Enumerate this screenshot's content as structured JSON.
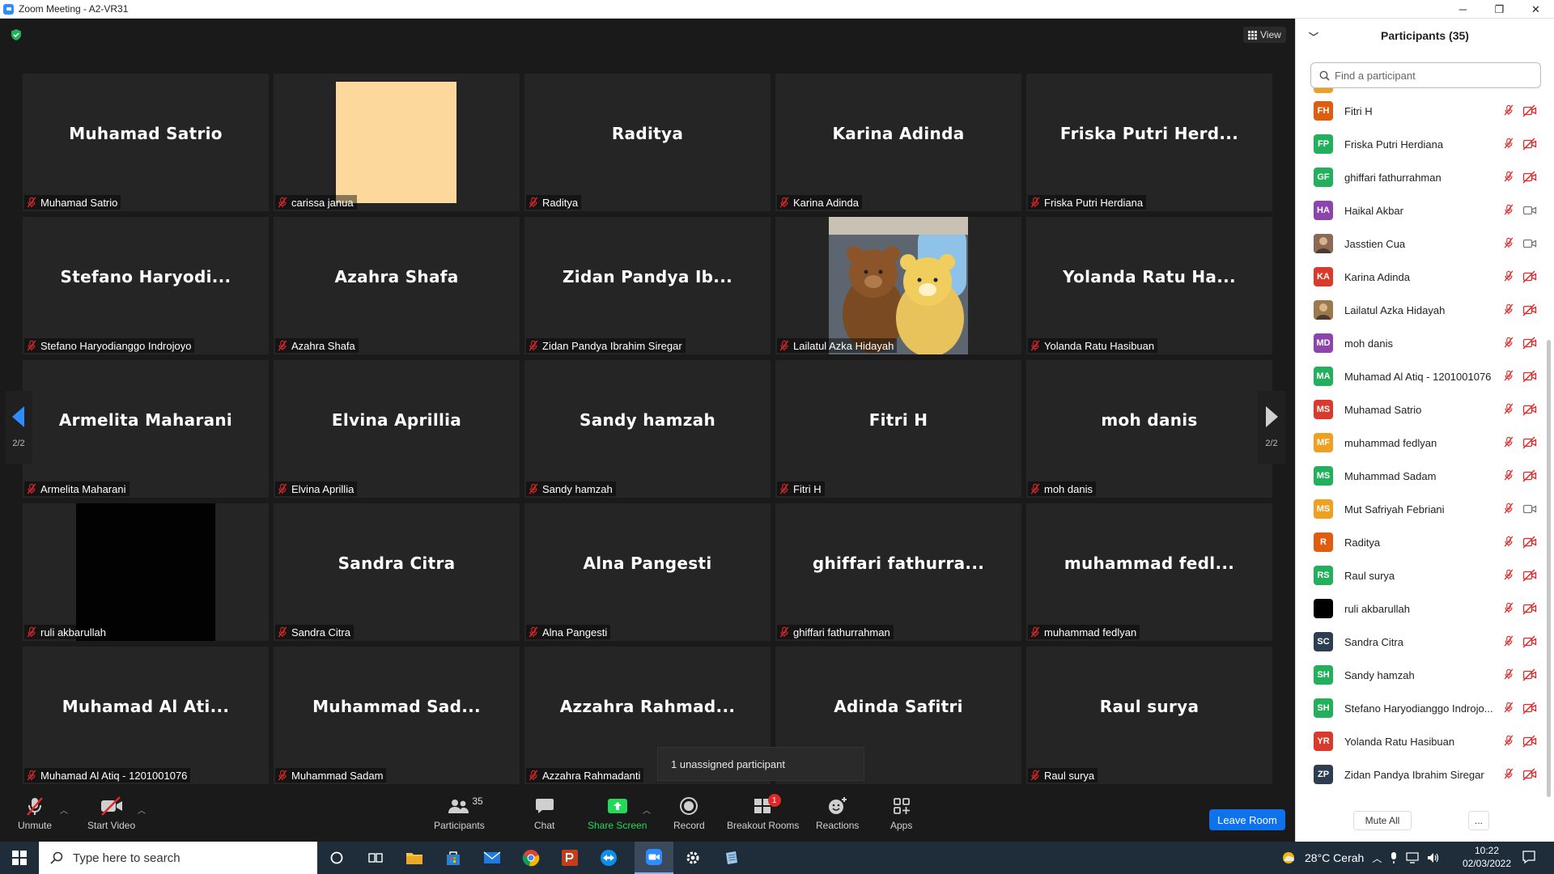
{
  "window": {
    "title": "Zoom Meeting - A2-VR31",
    "min": "─",
    "max": "❐",
    "close": "✕"
  },
  "view_label": "View",
  "pager": {
    "page": "2/2"
  },
  "tiles": [
    {
      "big": "Muhamad Satrio",
      "name": "Muhamad Satrio"
    },
    {
      "big": "",
      "name": "carissa janua",
      "photo": "peach"
    },
    {
      "big": "Raditya",
      "name": "Raditya"
    },
    {
      "big": "Karina Adinda",
      "name": "Karina Adinda"
    },
    {
      "big": "Friska Putri Herd...",
      "name": "Friska Putri Herdiana"
    },
    {
      "big": "Stefano  Haryodi...",
      "name": "Stefano Haryodianggo Indrojoyo"
    },
    {
      "big": "Azahra Shafa",
      "name": "Azahra Shafa"
    },
    {
      "big": "Zidan Pandya Ib...",
      "name": "Zidan Pandya Ibrahim Siregar"
    },
    {
      "big": "",
      "name": "Lailatul Azka Hidayah",
      "photo": "bears"
    },
    {
      "big": "Yolanda Ratu Ha...",
      "name": "Yolanda Ratu Hasibuan"
    },
    {
      "big": "Armelita Maharani",
      "name": "Armelita Maharani"
    },
    {
      "big": "Elvina Aprillia",
      "name": "Elvina Aprillia"
    },
    {
      "big": "Sandy hamzah",
      "name": "Sandy hamzah"
    },
    {
      "big": "Fitri H",
      "name": "Fitri H"
    },
    {
      "big": "moh danis",
      "name": "moh danis"
    },
    {
      "big": "",
      "name": "ruli akbarullah",
      "photo": "black"
    },
    {
      "big": "Sandra Citra",
      "name": "Sandra Citra"
    },
    {
      "big": "Alna Pangesti",
      "name": "Alna Pangesti"
    },
    {
      "big": "ghiffari  fathurra...",
      "name": "ghiffari fathurrahman"
    },
    {
      "big": "muhammad  fedl...",
      "name": "muhammad fedlyan"
    },
    {
      "big": "Muhamad Al Ati...",
      "name": "Muhamad Al Atiq - 1201001076"
    },
    {
      "big": "Muhammad  Sad...",
      "name": "Muhammad Sadam"
    },
    {
      "big": "Azzahra  Rahmad...",
      "name": "Azzahra Rahmadanti"
    },
    {
      "big": "Adinda Safitri",
      "name": ""
    },
    {
      "big": "Raul surya",
      "name": "Raul surya"
    }
  ],
  "unassigned_text": "1 unassigned participant",
  "toolbar": {
    "unmute": "Unmute",
    "start_video": "Start Video",
    "participants": "Participants",
    "participants_count": "35",
    "chat": "Chat",
    "share_screen": "Share Screen",
    "record": "Record",
    "breakout_rooms": "Breakout Rooms",
    "breakout_badge": "1",
    "reactions": "Reactions",
    "apps": "Apps",
    "leave_room": "Leave Room",
    "colors": {
      "share": "#23d959",
      "badge": "#e02828",
      "leave": "#0e72ed"
    }
  },
  "panel": {
    "title": "Participants (35)",
    "search_placeholder": "Find a participant",
    "mute_all": "Mute All",
    "more": "...",
    "participants": [
      {
        "initials": "FH",
        "name": "Fitri H",
        "color": "#e05d10",
        "cam": "off"
      },
      {
        "initials": "FP",
        "name": "Friska Putri Herdiana",
        "color": "#23b05c",
        "cam": "off"
      },
      {
        "initials": "GF",
        "name": "ghiffari fathurrahman",
        "color": "#23b05c",
        "cam": "off"
      },
      {
        "initials": "HA",
        "name": "Haikal Akbar",
        "color": "#8e44ad",
        "cam": "on"
      },
      {
        "initials": "",
        "name": "Jasstien Cua",
        "color": "#8a6a55",
        "cam": "on",
        "photo": true
      },
      {
        "initials": "KA",
        "name": "Karina Adinda",
        "color": "#d93a2b",
        "cam": "off"
      },
      {
        "initials": "",
        "name": "Lailatul Azka Hidayah",
        "color": "#9b7a4a",
        "cam": "off",
        "photo": true
      },
      {
        "initials": "MD",
        "name": "moh danis",
        "color": "#8e44ad",
        "cam": "off"
      },
      {
        "initials": "MA",
        "name": "Muhamad Al Atiq - 1201001076",
        "color": "#23b05c",
        "cam": "off"
      },
      {
        "initials": "MS",
        "name": "Muhamad Satrio",
        "color": "#d93a2b",
        "cam": "off"
      },
      {
        "initials": "MF",
        "name": "muhammad fedlyan",
        "color": "#f0a020",
        "cam": "off"
      },
      {
        "initials": "MS",
        "name": "Muhammad Sadam",
        "color": "#23b05c",
        "cam": "off"
      },
      {
        "initials": "MS",
        "name": "Mut Safriyah Febriani",
        "color": "#f0a020",
        "cam": "on"
      },
      {
        "initials": "R",
        "name": "Raditya",
        "color": "#e05d10",
        "cam": "off"
      },
      {
        "initials": "RS",
        "name": "Raul surya",
        "color": "#23b05c",
        "cam": "off"
      },
      {
        "initials": "",
        "name": "ruli akbarullah",
        "color": "#000000",
        "cam": "off"
      },
      {
        "initials": "SC",
        "name": "Sandra Citra",
        "color": "#2c3e50",
        "cam": "off"
      },
      {
        "initials": "SH",
        "name": "Sandy hamzah",
        "color": "#23b05c",
        "cam": "off"
      },
      {
        "initials": "SH",
        "name": "Stefano Haryodianggo Indrojo...",
        "color": "#23b05c",
        "cam": "off"
      },
      {
        "initials": "YR",
        "name": "Yolanda Ratu Hasibuan",
        "color": "#d93a2b",
        "cam": "off"
      },
      {
        "initials": "ZP",
        "name": "Zidan Pandya Ibrahim Siregar",
        "color": "#2c3e50",
        "cam": "off"
      }
    ]
  },
  "taskbar": {
    "search_placeholder": "Type here to search",
    "weather": "28°C  Cerah",
    "time": "10:22",
    "date": "02/03/2022"
  }
}
